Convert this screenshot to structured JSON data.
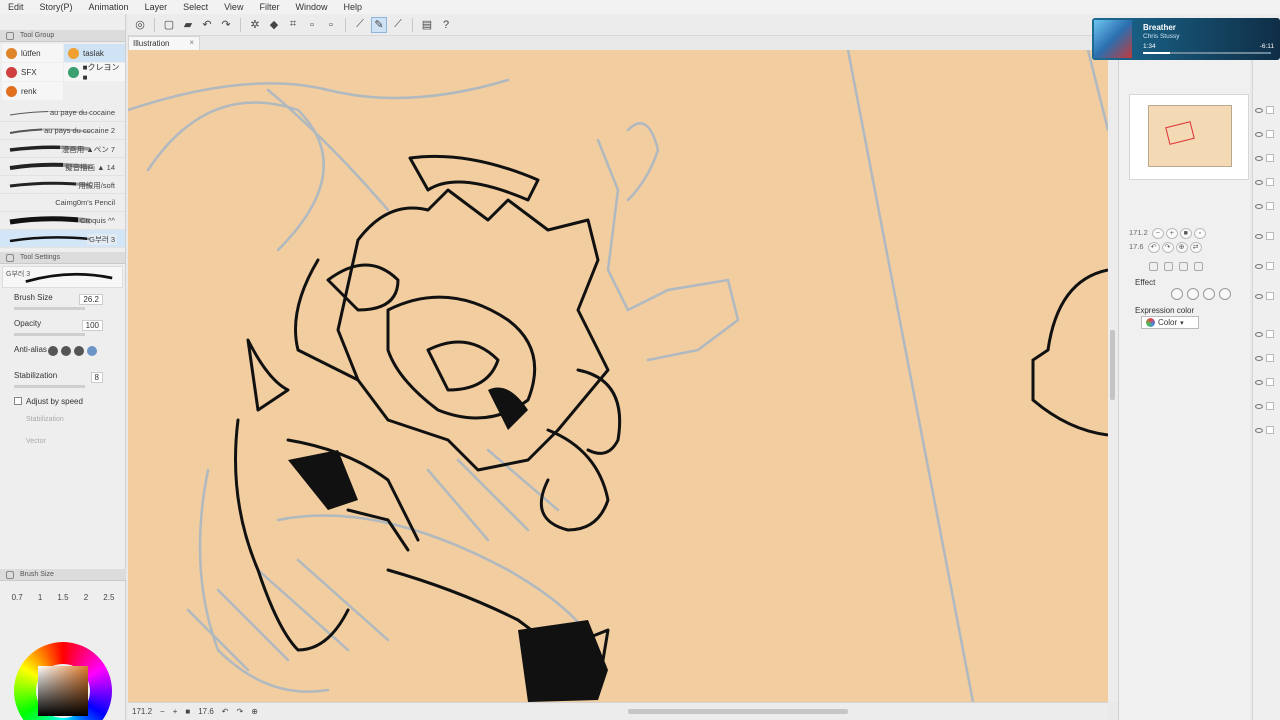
{
  "menu": [
    "Edit",
    "Story(P)",
    "Animation",
    "Layer",
    "Select",
    "View",
    "Filter",
    "Window",
    "Help"
  ],
  "canvas_tab": {
    "label": "Illustration",
    "close": "×"
  },
  "tool_group": {
    "header": "Tool Group",
    "groups": [
      {
        "label": "lütfen",
        "color": "#e0842a"
      },
      {
        "label": "taslak",
        "color": "#f0a030",
        "selected": true
      },
      {
        "label": "SFX",
        "color": "#d04040"
      },
      {
        "label": "■クレヨン ■",
        "color": "#3aa070"
      },
      {
        "label": "renk",
        "color": "#e07020"
      }
    ]
  },
  "brushes": [
    {
      "name": "au paye du cocaine"
    },
    {
      "name": "au pays du cocaine 2"
    },
    {
      "name": "漫画用 ▲ペン 7"
    },
    {
      "name": "擬音描画 ▲ 14"
    },
    {
      "name": "用線用/soft"
    },
    {
      "name": "Caimg0m's Pencil"
    },
    {
      "name": "Croquis ^^"
    },
    {
      "name": "G부러 3",
      "selected": true
    }
  ],
  "tool_settings": {
    "header": "Tool Settings",
    "preset_name": "G부러 3",
    "brush_size_label": "Brush Size",
    "brush_size_value": "26.2",
    "opacity_label": "Opacity",
    "opacity_value": "100",
    "antialias_label": "Anti-alias",
    "stabilization_label": "Stabilization",
    "stabilization_value": "8",
    "adjust_speed_label": "Adjust by speed",
    "stabilization_disabled": "Stabilization",
    "vector_disabled": "Vector"
  },
  "brush_size_panel": {
    "header": "Brush Size",
    "values": [
      "0.7",
      "1",
      "1.5",
      "2",
      "2.5"
    ]
  },
  "status": {
    "zoom": "171.2",
    "angle": "17.6"
  },
  "navigator": {
    "zoom": "171.2",
    "angle": "17.6"
  },
  "properties": {
    "effect_label": "Effect",
    "expression_color_label": "Expression color",
    "expression_color_value": "Color"
  },
  "music": {
    "title": "Breather",
    "artist": "Chris Stussy",
    "elapsed": "1:34",
    "remaining": "-6:11",
    "progress": 0.21
  }
}
